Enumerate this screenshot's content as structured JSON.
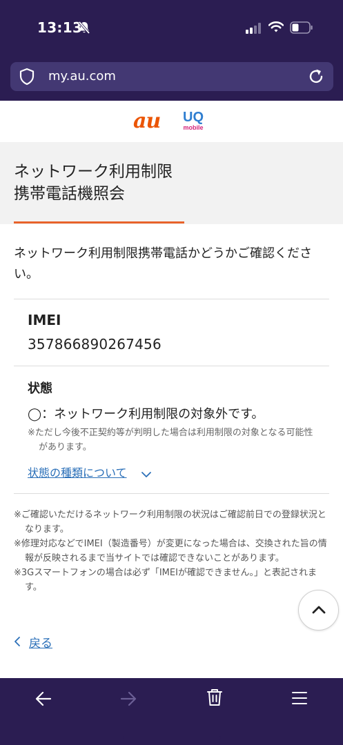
{
  "status_bar": {
    "time": "13:13"
  },
  "browser": {
    "url": "my.au.com"
  },
  "logos": {
    "au": "au",
    "uq": "UQ",
    "uq_sub": "mobile"
  },
  "page": {
    "title_line1": "ネットワーク利用制限",
    "title_line2": "携帯電話機照会",
    "intro": "ネットワーク利用制限携帯電話かどうかご確認ください。",
    "imei_label": "IMEI",
    "imei_value": "357866890267456",
    "status_label": "状態",
    "status_value": "◯：ネットワーク利用制限の対象外です。",
    "status_note": "※ただし今後不正契約等が判明した場合は利用制限の対象となる可能性があります。",
    "types_link": "状態の種類について",
    "notes": [
      "※ご確認いただけるネットワーク利用制限の状況はご確認前日での登録状況となります。",
      "※修理対応などでIMEI（製造番号）が変更になった場合は、交換された旨の情報が反映されるまで当サイトでは確認できないことがあります。",
      "※3Gスマートフォンの場合は必ず「IMEIが確認できません。」と表記されます。"
    ],
    "back_label": "戻る"
  },
  "colors": {
    "header_bg": "#2b1d52",
    "url_field_bg": "#433873",
    "accent_orange": "#e8622a",
    "link_blue": "#2a6fb8",
    "au_orange": "#eb5505",
    "uq_blue": "#2f7ed0",
    "uq_pink": "#d4237a"
  },
  "icons": {
    "status": [
      "bell-slash-icon",
      "cellular-signal-icon",
      "wifi-icon",
      "battery-icon"
    ],
    "browser": [
      "shield-icon",
      "reload-icon"
    ],
    "nav": [
      "back-arrow-icon",
      "forward-arrow-icon",
      "trash-icon",
      "menu-icon"
    ],
    "page": [
      "chevron-down-icon",
      "chevron-up-icon",
      "chevron-left-icon"
    ]
  }
}
